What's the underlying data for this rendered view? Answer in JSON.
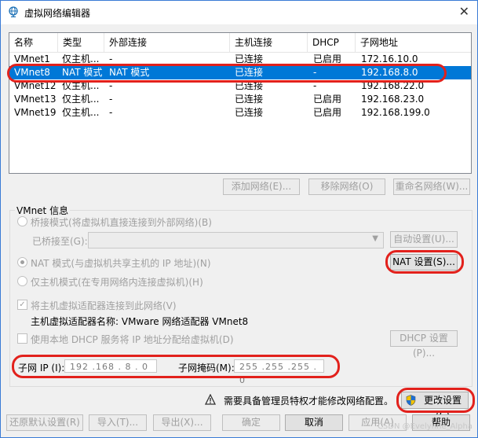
{
  "window": {
    "title": "虚拟网络编辑器",
    "close_glyph": "✕"
  },
  "table": {
    "headers": [
      "名称",
      "类型",
      "外部连接",
      "主机连接",
      "DHCP",
      "子网地址"
    ],
    "rows": [
      [
        "VMnet1",
        "仅主机...",
        "-",
        "已连接",
        "已启用",
        "172.16.10.0"
      ],
      [
        "VMnet8",
        "NAT 模式",
        "NAT 模式",
        "已连接",
        "-",
        "192.168.8.0"
      ],
      [
        "VMnet12",
        "仅主机...",
        "-",
        "已连接",
        "-",
        "192.168.22.0"
      ],
      [
        "VMnet13",
        "仅主机...",
        "-",
        "已连接",
        "已启用",
        "192.168.23.0"
      ],
      [
        "VMnet19",
        "仅主机...",
        "-",
        "已连接",
        "已启用",
        "192.168.199.0"
      ]
    ],
    "selected_row": 1
  },
  "network_buttons": {
    "add": "添加网络(E)...",
    "remove": "移除网络(O)",
    "rename": "重命名网络(W)..."
  },
  "vmnet_info": {
    "title": "VMnet 信息",
    "bridge_mode": "桥接模式(将虚拟机直接连接到外部网络)(B)",
    "bridged_to_label": "已桥接至(G):",
    "auto_settings": "自动设置(U)...",
    "nat_mode": "NAT 模式(与虚拟机共享主机的 IP 地址)(N)",
    "nat_settings": "NAT 设置(S)...",
    "host_only_mode": "仅主机模式(在专用网络内连接虚拟机)(H)",
    "connect_adapter": "将主机虚拟适配器连接到此网络(V)",
    "adapter_name_label": "主机虚拟适配器名称: VMware 网络适配器 VMnet8",
    "use_dhcp": "使用本地 DHCP 服务将 IP 地址分配给虚拟机(D)",
    "dhcp_settings": "DHCP 设置(P)...",
    "subnet_ip_label": "子网 IP (I):",
    "subnet_ip_value": "192 .168 . 8 . 0",
    "subnet_mask_label": "子网掩码(M):",
    "subnet_mask_value": "255 .255 .255 . 0"
  },
  "admin_notice": "需要具备管理员特权才能修改网络配置。",
  "change_settings": "更改设置(C)",
  "footer_buttons": {
    "restore": "还原默认设置(R)",
    "import": "导入(T)...",
    "export": "导出(X)...",
    "ok": "确定",
    "cancel": "取消",
    "apply": "应用(A)",
    "help": "帮助"
  },
  "watermark": "CSDN @Evelynne_Alpha",
  "colors": {
    "selection": "#0078d7",
    "annotation": "#e2211c",
    "disabled_text": "#a0a0a0"
  }
}
